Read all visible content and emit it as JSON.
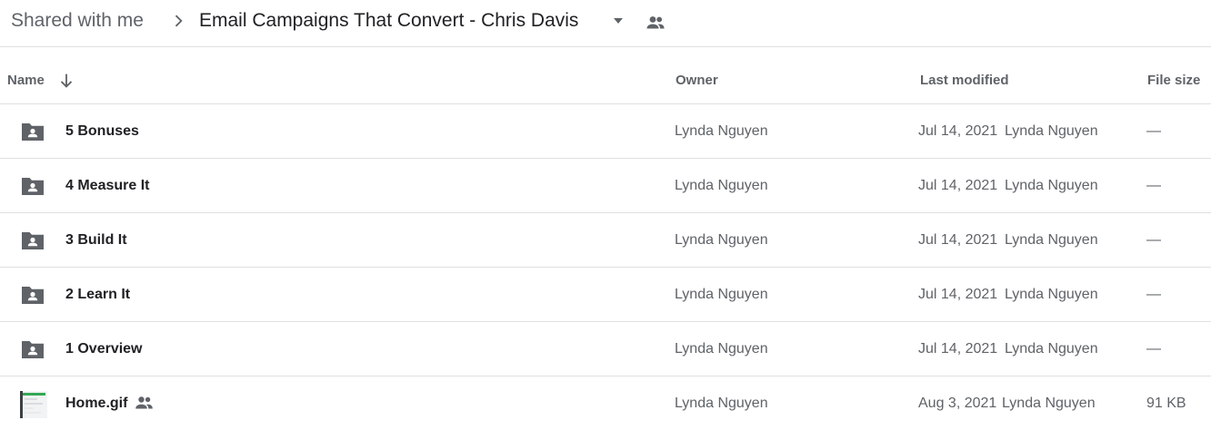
{
  "breadcrumb": {
    "root": "Shared with me",
    "current": "Email Campaigns That Convert - Chris Davis"
  },
  "columns": {
    "name": "Name",
    "owner": "Owner",
    "last_modified": "Last modified",
    "file_size": "File size"
  },
  "sort": {
    "column": "Name",
    "direction": "descending"
  },
  "files": [
    {
      "name": "5 Bonuses",
      "type": "shared-folder",
      "owner": "Lynda Nguyen",
      "modified_date": "Jul 14, 2021",
      "modified_by": "Lynda Nguyen",
      "size": "—"
    },
    {
      "name": "4 Measure It",
      "type": "shared-folder",
      "owner": "Lynda Nguyen",
      "modified_date": "Jul 14, 2021",
      "modified_by": "Lynda Nguyen",
      "size": "—"
    },
    {
      "name": "3 Build It",
      "type": "shared-folder",
      "owner": "Lynda Nguyen",
      "modified_date": "Jul 14, 2021",
      "modified_by": "Lynda Nguyen",
      "size": "—"
    },
    {
      "name": "2 Learn It",
      "type": "shared-folder",
      "owner": "Lynda Nguyen",
      "modified_date": "Jul 14, 2021",
      "modified_by": "Lynda Nguyen",
      "size": "—"
    },
    {
      "name": "1 Overview",
      "type": "shared-folder",
      "owner": "Lynda Nguyen",
      "modified_date": "Jul 14, 2021",
      "modified_by": "Lynda Nguyen",
      "size": "—"
    },
    {
      "name": "Home.gif",
      "type": "gif-image",
      "shared": true,
      "owner": "Lynda Nguyen",
      "modified_date": "Aug 3, 2021",
      "modified_by": "Lynda Nguyen",
      "size": "91 KB"
    }
  ],
  "icons": {
    "breadcrumb_separator": "chevron-right-icon",
    "breadcrumb_dropdown": "caret-down-icon",
    "shared_indicator": "people-icon",
    "sort": "arrow-down-icon",
    "folder": "shared-folder-icon",
    "image": "image-thumbnail"
  },
  "colors": {
    "text_primary": "#202124",
    "text_secondary": "#5f6368",
    "icon_gray": "#5f6368",
    "divider": "#e0e0e0",
    "thumb_green": "#34a853"
  }
}
